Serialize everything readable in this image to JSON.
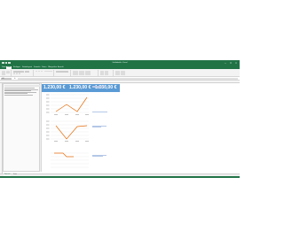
{
  "window": {
    "title": "Geldtabelle - Excel",
    "controls": {
      "minimize": "–",
      "maximize": "□",
      "close": "×"
    }
  },
  "ribbon_tabs": [
    {
      "label": "Datei",
      "active": false
    },
    {
      "label": "Start",
      "active": true
    },
    {
      "label": "Einfügen",
      "active": false
    },
    {
      "label": "Seitenlayout",
      "active": false
    },
    {
      "label": "Formeln",
      "active": false
    },
    {
      "label": "Daten",
      "active": false
    },
    {
      "label": "Überprüfen",
      "active": false
    },
    {
      "label": "Ansicht",
      "active": false
    }
  ],
  "formula_bar": {
    "name_box": "A1",
    "fx_label": "fx",
    "value": ""
  },
  "kpis": [
    {
      "value": "1.230,00 €"
    },
    {
      "value": "1.230,00 €"
    },
    {
      "value": "1.230,00 €"
    }
  ],
  "charts": [
    {
      "accent": "#e46c0a",
      "grid": "#e3e3e3"
    },
    {
      "accent": "#e46c0a",
      "grid": "#e3e3e3"
    },
    {
      "accent": "#e46c0a",
      "grid": "#e3e3e3"
    }
  ],
  "sheet_tabs": [
    {
      "label": "Übersicht",
      "active": true
    },
    {
      "label": "Daten",
      "active": false
    }
  ],
  "status": {
    "left": "Bereit",
    "zoom": "100 %"
  },
  "colors": {
    "excel_green": "#217346",
    "kpi_blue": "#5b9bd5",
    "chart_orange": "#e46c0a",
    "note_blue": "#2e75b6"
  }
}
